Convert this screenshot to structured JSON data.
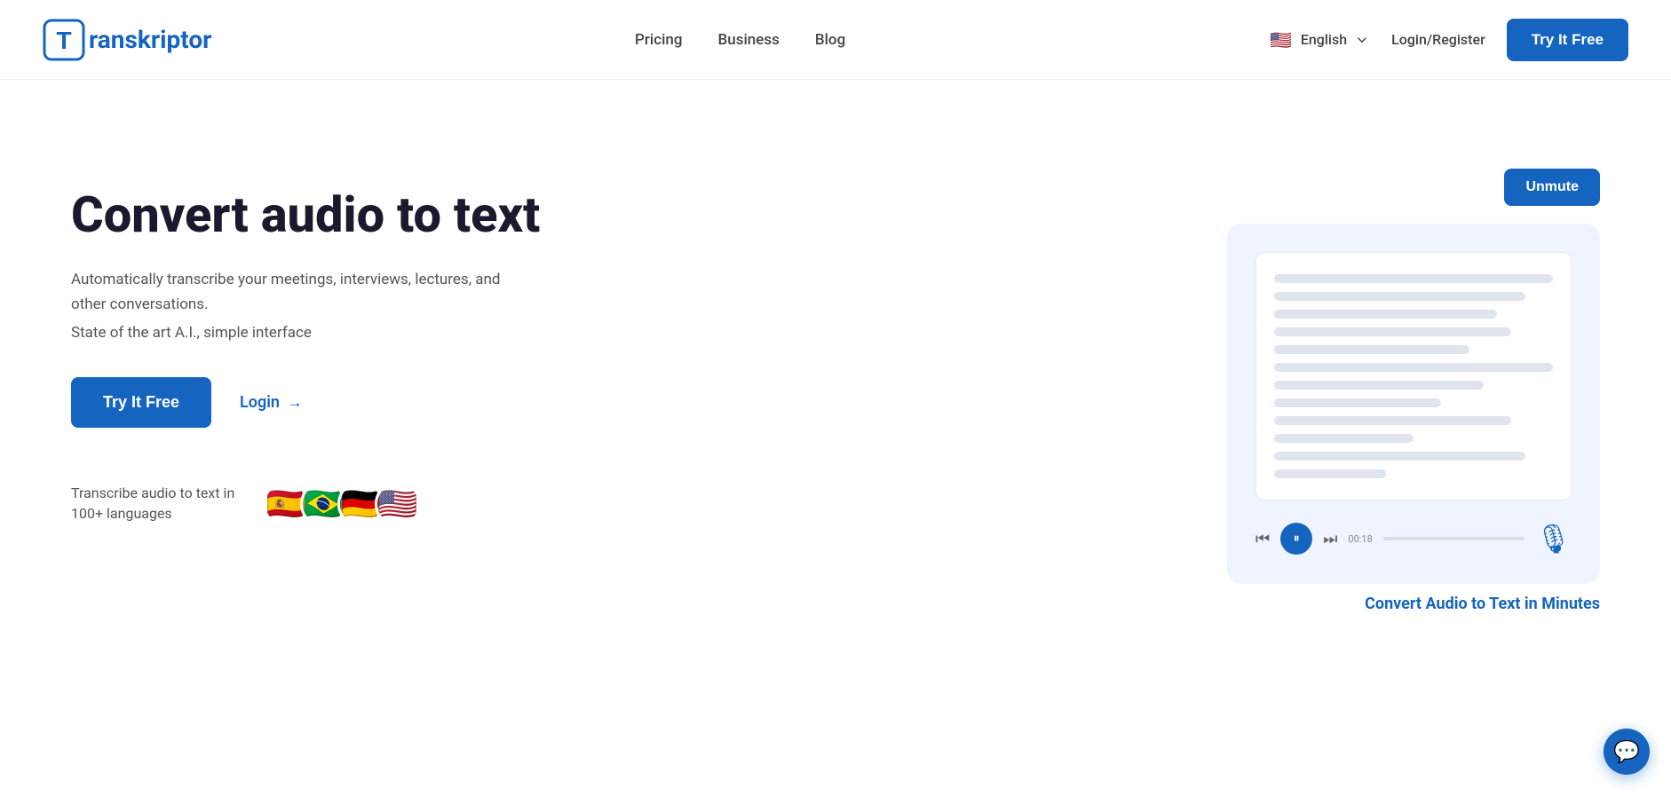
{
  "brand": {
    "name": "Transkriptor",
    "name_prefix": "T",
    "name_suffix": "ranskriptor",
    "logo_alt": "Transkriptor logo"
  },
  "nav": {
    "links": [
      {
        "label": "Pricing",
        "href": "#"
      },
      {
        "label": "Business",
        "href": "#"
      },
      {
        "label": "Blog",
        "href": "#"
      }
    ],
    "language": {
      "label": "English",
      "flag": "🇺🇸"
    },
    "login_label": "Login/Register",
    "cta_label": "Try It Free"
  },
  "hero": {
    "title": "Convert audio to text",
    "subtitle": "Automatically transcribe your meetings, interviews, lectures, and other conversations.",
    "feature": "State of the art A.I., simple interface",
    "cta_primary": "Try It Free",
    "cta_login": "Login",
    "languages_text": "Transcribe audio to text in 100+ languages",
    "flags": [
      "🇪🇸",
      "🇧🇷",
      "🇩🇪",
      "🇺🇸"
    ],
    "unmute_label": "Unmute",
    "card_caption": "Convert Audio to Text in Minutes",
    "audio_time": "00:18"
  }
}
